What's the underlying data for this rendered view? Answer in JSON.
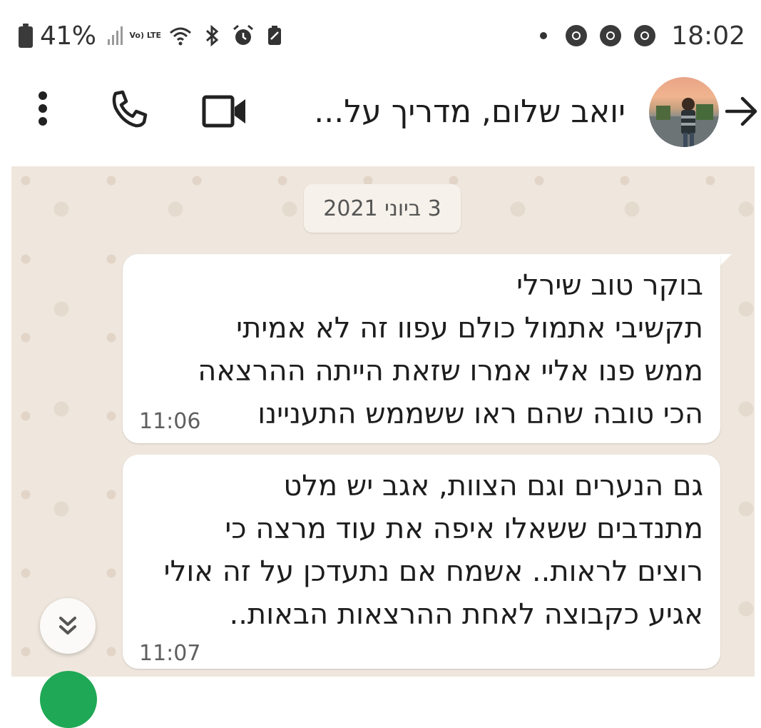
{
  "status_bar": {
    "battery": "41%",
    "network_label": "Vo) LTE",
    "time": "18:02",
    "icons": [
      "battery-icon",
      "signal-icon",
      "volte-icon",
      "wifi-icon",
      "bluetooth-icon",
      "alarm-icon",
      "battery-saver-icon",
      "chrome-icon",
      "chrome-icon",
      "chrome-icon"
    ]
  },
  "app_bar": {
    "title": "יואב שלום, מדריך על...",
    "icons": [
      "back-arrow-icon",
      "avatar",
      "video-call-icon",
      "phone-icon",
      "more-options-icon"
    ]
  },
  "chat": {
    "date_chip": "3 ביוני 2021",
    "messages": [
      {
        "lines": [
          "בוקר טוב שירלי",
          "תקשיבי אתמול כולם עפוו זה לא אמיתי",
          "ממש פנו אליי אמרו שזאת הייתה ההרצאה",
          "הכי טובה שהם ראו ששממש התעניינו"
        ],
        "time": "11:06"
      },
      {
        "lines": [
          "גם הנערים וגם הצוות, אגב יש מלט",
          "מתנדבים ששאלו איפה את עוד מרצה כי",
          "רוצים לראות.. אשמח אם נתעדכן על זה אולי",
          "אגיע כקבוצה לאחת ההרצאות הבאות.."
        ],
        "time": "11:07"
      }
    ]
  },
  "colors": {
    "chat_background": "#efe7dd",
    "bubble": "#ffffff",
    "fab": "#1fa855"
  }
}
